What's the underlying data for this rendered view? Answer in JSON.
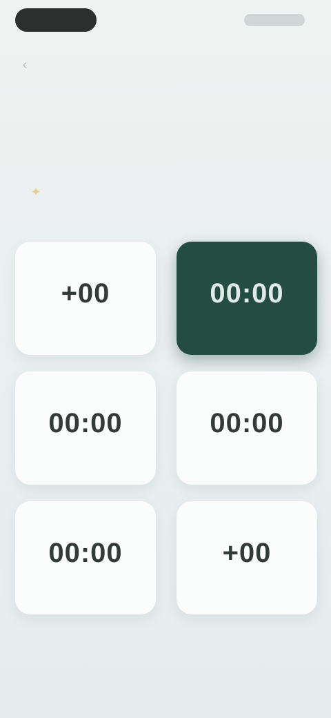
{
  "status_bar": {
    "time": "",
    "icons": [
      "signal-icon",
      "wifi-icon",
      "battery-icon"
    ]
  },
  "header": {
    "back_icon": "chevron-left-icon",
    "breadcrumb": ""
  },
  "title": "",
  "hint": {
    "icon": "lightbulb-icon",
    "text": ""
  },
  "time_slots": [
    {
      "time": "+00",
      "sub": "",
      "selected": false
    },
    {
      "time": "00:00",
      "sub": "",
      "selected": true
    },
    {
      "time": "00:00",
      "sub": "",
      "selected": false
    },
    {
      "time": "00:00",
      "sub": "",
      "selected": false
    },
    {
      "time": "00:00",
      "sub": "",
      "selected": false
    },
    {
      "time": "+00",
      "sub": "",
      "selected": false
    }
  ],
  "colors": {
    "selected_card": "#244d42",
    "card": "#fbfcfc",
    "background": "#eef2f1",
    "hint_icon": "#e3d08a"
  }
}
